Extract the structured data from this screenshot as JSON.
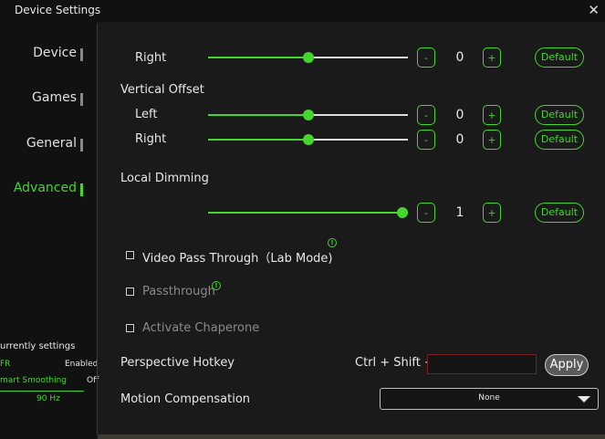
{
  "window": {
    "title": "Device Settings",
    "close_glyph": "✕"
  },
  "nav": {
    "items": [
      {
        "label": "Device",
        "active": false
      },
      {
        "label": "Games",
        "active": false
      },
      {
        "label": "General",
        "active": false
      },
      {
        "label": "Advanced",
        "active": true
      }
    ]
  },
  "current_settings": {
    "title": "urrently settings",
    "rows": [
      {
        "name": "FR",
        "value": "Enabled"
      },
      {
        "name": "mart Smoothing",
        "value": "Off"
      }
    ],
    "refresh": "90 Hz"
  },
  "main": {
    "right_top": {
      "label": "Right",
      "value": "0",
      "level": 0.5
    },
    "vertical_offset": {
      "heading": "Vertical Offset",
      "left": {
        "label": "Left",
        "value": "0",
        "level": 0.5
      },
      "right": {
        "label": "Right",
        "value": "0",
        "level": 0.5
      }
    },
    "local_dimming": {
      "heading": "Local Dimming",
      "value": "1",
      "level": 1.0
    },
    "buttons": {
      "minus": "-",
      "plus": "+",
      "default": "Default"
    },
    "checkboxes": [
      {
        "label": "Video Pass Through（Lab Mode)",
        "checked": false,
        "enabled": true,
        "info": true
      },
      {
        "label": "Passthrough",
        "checked": false,
        "enabled": false,
        "info": true
      },
      {
        "label": "Activate Chaperone",
        "checked": false,
        "enabled": false,
        "info": false
      }
    ],
    "info_glyph": "!",
    "hotkey": {
      "label": "Perspective Hotkey",
      "prefix": "Ctrl + Shift +",
      "value": "",
      "apply": "Apply"
    },
    "motion": {
      "label": "Motion Compensation",
      "selected": "None"
    }
  },
  "colors": {
    "accent": "#44d62c",
    "background": "#1a1a1a",
    "sidebar": "#111111"
  }
}
